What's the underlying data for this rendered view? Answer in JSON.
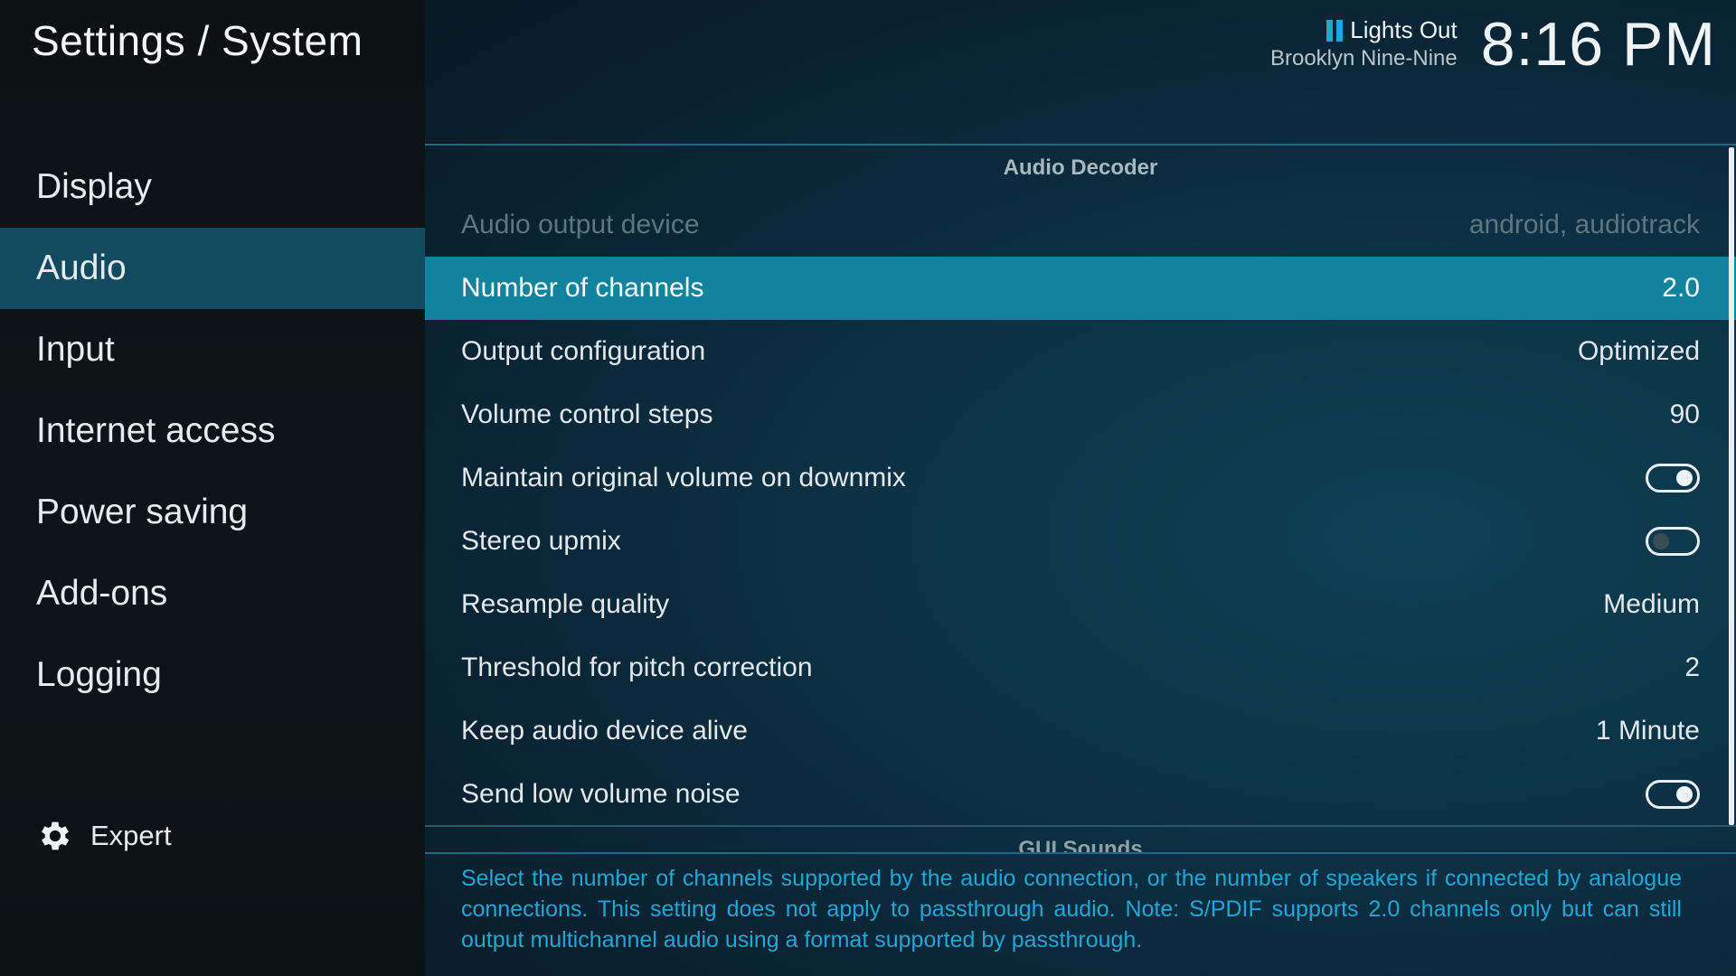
{
  "header": {
    "title": "Settings / System",
    "now_playing_title": "Lights Out",
    "now_playing_show": "Brooklyn Nine-Nine",
    "clock": "8:16 PM"
  },
  "sidebar": {
    "items": [
      {
        "label": "Display"
      },
      {
        "label": "Audio"
      },
      {
        "label": "Input"
      },
      {
        "label": "Internet access"
      },
      {
        "label": "Power saving"
      },
      {
        "label": "Add-ons"
      },
      {
        "label": "Logging"
      }
    ],
    "active_index": 1,
    "expert_label": "Expert"
  },
  "section": {
    "title": "Audio Decoder",
    "next_title": "GUI Sounds"
  },
  "settings": [
    {
      "label": "Audio output device",
      "value": "android, audiotrack",
      "disabled": true
    },
    {
      "label": "Number of channels",
      "value": "2.0",
      "selected": true
    },
    {
      "label": "Output configuration",
      "value": "Optimized"
    },
    {
      "label": "Volume control steps",
      "value": "90"
    },
    {
      "label": "Maintain original volume on downmix",
      "toggle": "on"
    },
    {
      "label": "Stereo upmix",
      "toggle": "off"
    },
    {
      "label": "Resample quality",
      "value": "Medium"
    },
    {
      "label": "Threshold for pitch correction",
      "value": "2"
    },
    {
      "label": "Keep audio device alive",
      "value": "1 Minute"
    },
    {
      "label": "Send low volume noise",
      "toggle": "on"
    }
  ],
  "description": "Select the number of channels supported by the audio connection, or the number of speakers if connected by analogue connections. This setting does not apply to passthrough audio. Note: S/PDIF supports 2.0 channels only but can still output multichannel audio using a format supported by passthrough.",
  "colors": {
    "accent": "#1ea7d8",
    "selected_row": "#12839f",
    "active_nav": "#124a5f"
  }
}
